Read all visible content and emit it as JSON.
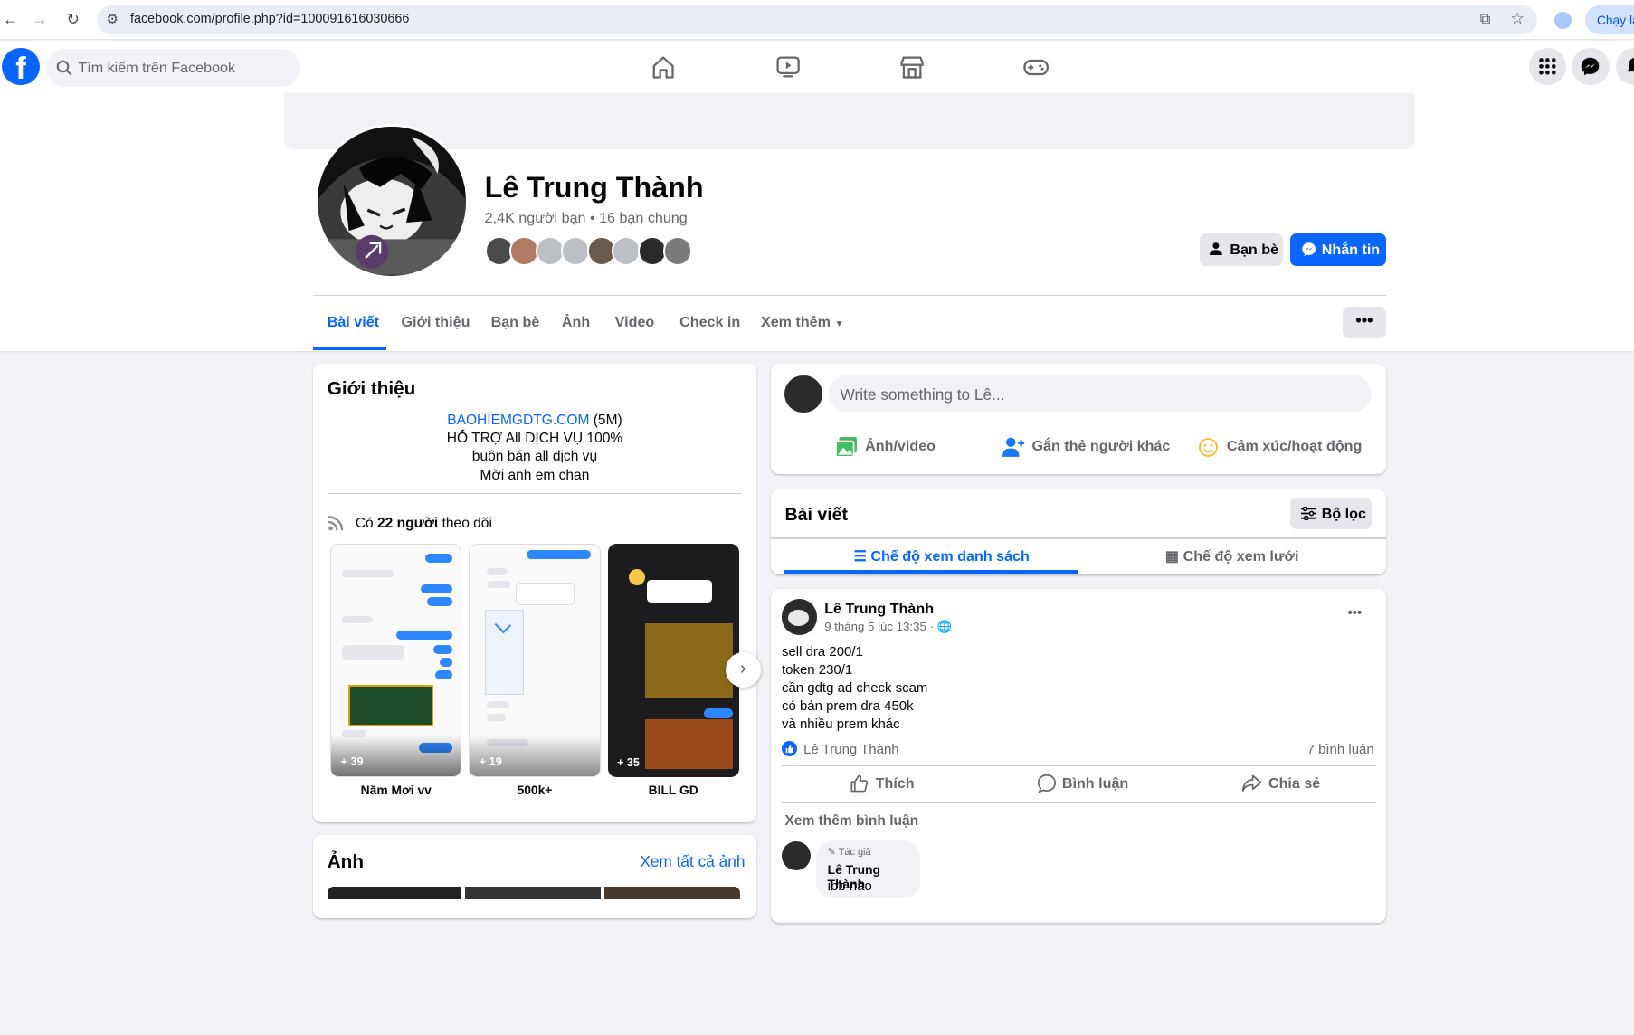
{
  "browser": {
    "url": "facebook.com/profile.php?id=100091616030666",
    "run_button": "Chạy lại"
  },
  "header": {
    "logo": "f",
    "search_placeholder": "Tìm kiếm trên Facebook"
  },
  "profile": {
    "name": "Lê Trung Thành",
    "meta": "2,4K người bạn • 16 bạn chung",
    "friend_button": "Bạn bè",
    "message_button": "Nhắn tin",
    "tabs": [
      "Bài viết",
      "Giới thiệu",
      "Bạn bè",
      "Ảnh",
      "Video",
      "Check in",
      "Xem thêm"
    ],
    "more": "•••"
  },
  "intro": {
    "title": "Giới thiệu",
    "link": "BAOHIEMGDTG.COM",
    "link_suffix": " (5M)",
    "bio_lines": [
      "HỖ TRỢ All DỊCH VỤ 100%",
      "buôn bán all dịch vụ",
      "Mời anh em chan"
    ],
    "followers_prefix": "Có ",
    "followers_count": "22 người",
    "followers_suffix": " theo dõi",
    "stories": [
      {
        "caption": "Năm Mơi vv",
        "plus": "+ 39"
      },
      {
        "caption": "500k+",
        "plus": "+ 19"
      },
      {
        "caption": "BILL GD",
        "plus": "+ 35"
      }
    ]
  },
  "photos": {
    "title": "Ảnh",
    "see_all": "Xem tất cả ảnh"
  },
  "composer": {
    "placeholder": "Write something to Lê...",
    "photo": "Ảnh/video",
    "tag": "Gắn thẻ người khác",
    "feeling": "Cảm xúc/hoạt động"
  },
  "posts_header": {
    "title": "Bài viết",
    "filter": "Bộ lọc",
    "list_view": "Chế độ xem danh sách",
    "grid_view": "Chế độ xem lưới"
  },
  "post": {
    "author": "Lê Trung Thành",
    "time": "9 tháng 5 lúc 13:35 ·",
    "lines": [
      "sell dra 200/1",
      "token 230/1",
      "cần gdtg ad check scam",
      "có bán prem dra 450k",
      "và nhiều prem khác"
    ],
    "reactor": "Lê Trung Thành",
    "comments_count": "7 bình luận",
    "like": "Thích",
    "comment": "Bình luận",
    "share": "Chia sẻ",
    "more_comments": "Xem thêm bình luận",
    "comment_badge": "Tác giả",
    "comment_author": "Lê Trung Thành",
    "comment_text": "ibb nào",
    "dots": "•••"
  },
  "colors": {
    "brand": "#0866ff",
    "bg": "#f0f2f5",
    "secondary_text": "#65676b"
  }
}
